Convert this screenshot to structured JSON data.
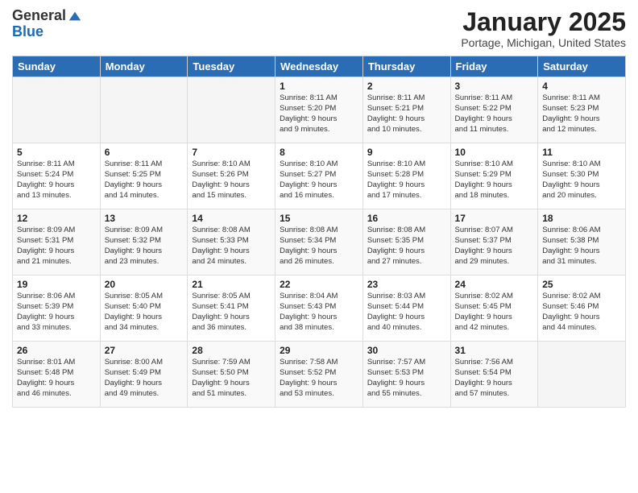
{
  "logo": {
    "general": "General",
    "blue": "Blue"
  },
  "title": "January 2025",
  "subtitle": "Portage, Michigan, United States",
  "days": [
    "Sunday",
    "Monday",
    "Tuesday",
    "Wednesday",
    "Thursday",
    "Friday",
    "Saturday"
  ],
  "weeks": [
    [
      {
        "day": "",
        "info": ""
      },
      {
        "day": "",
        "info": ""
      },
      {
        "day": "",
        "info": ""
      },
      {
        "day": "1",
        "info": "Sunrise: 8:11 AM\nSunset: 5:20 PM\nDaylight: 9 hours\nand 9 minutes."
      },
      {
        "day": "2",
        "info": "Sunrise: 8:11 AM\nSunset: 5:21 PM\nDaylight: 9 hours\nand 10 minutes."
      },
      {
        "day": "3",
        "info": "Sunrise: 8:11 AM\nSunset: 5:22 PM\nDaylight: 9 hours\nand 11 minutes."
      },
      {
        "day": "4",
        "info": "Sunrise: 8:11 AM\nSunset: 5:23 PM\nDaylight: 9 hours\nand 12 minutes."
      }
    ],
    [
      {
        "day": "5",
        "info": "Sunrise: 8:11 AM\nSunset: 5:24 PM\nDaylight: 9 hours\nand 13 minutes."
      },
      {
        "day": "6",
        "info": "Sunrise: 8:11 AM\nSunset: 5:25 PM\nDaylight: 9 hours\nand 14 minutes."
      },
      {
        "day": "7",
        "info": "Sunrise: 8:10 AM\nSunset: 5:26 PM\nDaylight: 9 hours\nand 15 minutes."
      },
      {
        "day": "8",
        "info": "Sunrise: 8:10 AM\nSunset: 5:27 PM\nDaylight: 9 hours\nand 16 minutes."
      },
      {
        "day": "9",
        "info": "Sunrise: 8:10 AM\nSunset: 5:28 PM\nDaylight: 9 hours\nand 17 minutes."
      },
      {
        "day": "10",
        "info": "Sunrise: 8:10 AM\nSunset: 5:29 PM\nDaylight: 9 hours\nand 18 minutes."
      },
      {
        "day": "11",
        "info": "Sunrise: 8:10 AM\nSunset: 5:30 PM\nDaylight: 9 hours\nand 20 minutes."
      }
    ],
    [
      {
        "day": "12",
        "info": "Sunrise: 8:09 AM\nSunset: 5:31 PM\nDaylight: 9 hours\nand 21 minutes."
      },
      {
        "day": "13",
        "info": "Sunrise: 8:09 AM\nSunset: 5:32 PM\nDaylight: 9 hours\nand 23 minutes."
      },
      {
        "day": "14",
        "info": "Sunrise: 8:08 AM\nSunset: 5:33 PM\nDaylight: 9 hours\nand 24 minutes."
      },
      {
        "day": "15",
        "info": "Sunrise: 8:08 AM\nSunset: 5:34 PM\nDaylight: 9 hours\nand 26 minutes."
      },
      {
        "day": "16",
        "info": "Sunrise: 8:08 AM\nSunset: 5:35 PM\nDaylight: 9 hours\nand 27 minutes."
      },
      {
        "day": "17",
        "info": "Sunrise: 8:07 AM\nSunset: 5:37 PM\nDaylight: 9 hours\nand 29 minutes."
      },
      {
        "day": "18",
        "info": "Sunrise: 8:06 AM\nSunset: 5:38 PM\nDaylight: 9 hours\nand 31 minutes."
      }
    ],
    [
      {
        "day": "19",
        "info": "Sunrise: 8:06 AM\nSunset: 5:39 PM\nDaylight: 9 hours\nand 33 minutes."
      },
      {
        "day": "20",
        "info": "Sunrise: 8:05 AM\nSunset: 5:40 PM\nDaylight: 9 hours\nand 34 minutes."
      },
      {
        "day": "21",
        "info": "Sunrise: 8:05 AM\nSunset: 5:41 PM\nDaylight: 9 hours\nand 36 minutes."
      },
      {
        "day": "22",
        "info": "Sunrise: 8:04 AM\nSunset: 5:43 PM\nDaylight: 9 hours\nand 38 minutes."
      },
      {
        "day": "23",
        "info": "Sunrise: 8:03 AM\nSunset: 5:44 PM\nDaylight: 9 hours\nand 40 minutes."
      },
      {
        "day": "24",
        "info": "Sunrise: 8:02 AM\nSunset: 5:45 PM\nDaylight: 9 hours\nand 42 minutes."
      },
      {
        "day": "25",
        "info": "Sunrise: 8:02 AM\nSunset: 5:46 PM\nDaylight: 9 hours\nand 44 minutes."
      }
    ],
    [
      {
        "day": "26",
        "info": "Sunrise: 8:01 AM\nSunset: 5:48 PM\nDaylight: 9 hours\nand 46 minutes."
      },
      {
        "day": "27",
        "info": "Sunrise: 8:00 AM\nSunset: 5:49 PM\nDaylight: 9 hours\nand 49 minutes."
      },
      {
        "day": "28",
        "info": "Sunrise: 7:59 AM\nSunset: 5:50 PM\nDaylight: 9 hours\nand 51 minutes."
      },
      {
        "day": "29",
        "info": "Sunrise: 7:58 AM\nSunset: 5:52 PM\nDaylight: 9 hours\nand 53 minutes."
      },
      {
        "day": "30",
        "info": "Sunrise: 7:57 AM\nSunset: 5:53 PM\nDaylight: 9 hours\nand 55 minutes."
      },
      {
        "day": "31",
        "info": "Sunrise: 7:56 AM\nSunset: 5:54 PM\nDaylight: 9 hours\nand 57 minutes."
      },
      {
        "day": "",
        "info": ""
      }
    ]
  ]
}
